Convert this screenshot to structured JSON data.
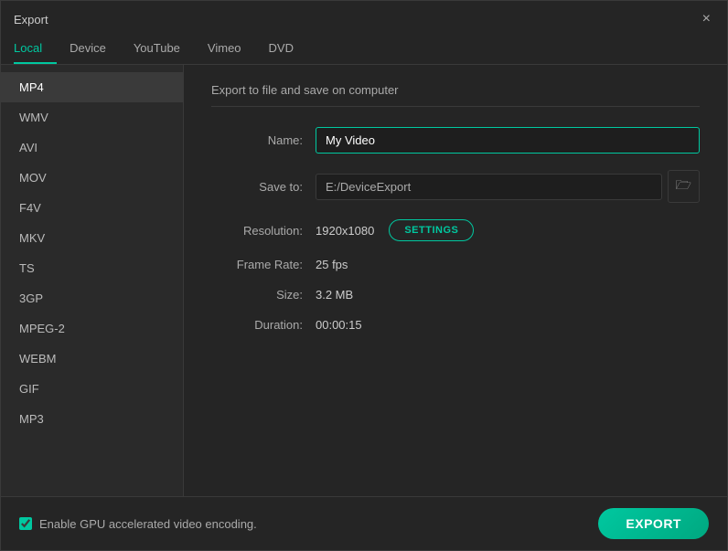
{
  "window": {
    "title": "Export",
    "close_label": "×"
  },
  "tabs": [
    {
      "id": "local",
      "label": "Local",
      "active": true
    },
    {
      "id": "device",
      "label": "Device",
      "active": false
    },
    {
      "id": "youtube",
      "label": "YouTube",
      "active": false
    },
    {
      "id": "vimeo",
      "label": "Vimeo",
      "active": false
    },
    {
      "id": "dvd",
      "label": "DVD",
      "active": false
    }
  ],
  "sidebar": {
    "items": [
      {
        "id": "mp4",
        "label": "MP4",
        "active": true
      },
      {
        "id": "wmv",
        "label": "WMV",
        "active": false
      },
      {
        "id": "avi",
        "label": "AVI",
        "active": false
      },
      {
        "id": "mov",
        "label": "MOV",
        "active": false
      },
      {
        "id": "f4v",
        "label": "F4V",
        "active": false
      },
      {
        "id": "mkv",
        "label": "MKV",
        "active": false
      },
      {
        "id": "ts",
        "label": "TS",
        "active": false
      },
      {
        "id": "3gp",
        "label": "3GP",
        "active": false
      },
      {
        "id": "mpeg2",
        "label": "MPEG-2",
        "active": false
      },
      {
        "id": "webm",
        "label": "WEBM",
        "active": false
      },
      {
        "id": "gif",
        "label": "GIF",
        "active": false
      },
      {
        "id": "mp3",
        "label": "MP3",
        "active": false
      }
    ]
  },
  "panel": {
    "title": "Export to file and save on computer",
    "fields": {
      "name_label": "Name:",
      "name_value": "My Video",
      "save_to_label": "Save to:",
      "save_to_path": "E:/DeviceExport",
      "resolution_label": "Resolution:",
      "resolution_value": "1920x1080",
      "settings_label": "SETTINGS",
      "frame_rate_label": "Frame Rate:",
      "frame_rate_value": "25 fps",
      "size_label": "Size:",
      "size_value": "3.2 MB",
      "duration_label": "Duration:",
      "duration_value": "00:00:15"
    }
  },
  "bottom": {
    "gpu_label": "Enable GPU accelerated video encoding.",
    "export_label": "EXPORT"
  },
  "icons": {
    "folder": "🗁",
    "close": "✕",
    "checkbox_checked": "✓"
  }
}
